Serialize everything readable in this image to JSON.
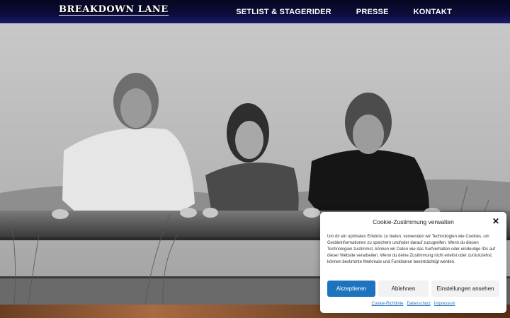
{
  "header": {
    "logo": "Breakdown Lane",
    "nav": [
      {
        "label": "SETLIST & STAGERIDER"
      },
      {
        "label": "PRESSE"
      },
      {
        "label": "KONTAKT"
      }
    ]
  },
  "cookie": {
    "title": "Cookie-Zustimmung verwalten",
    "close": "✕",
    "text": "Um dir ein optimales Erlebnis zu bieten, verwenden wir Technologien wie Cookies, um Geräteinformationen zu speichern und/oder darauf zuzugreifen. Wenn du diesen Technologien zustimmst, können wir Daten wie das Surfverhalten oder eindeutige IDs auf dieser Website verarbeiten. Wenn du deine Zustimmung nicht erteilst oder zurückziehst, können bestimmte Merkmale und Funktionen beeinträchtigt werden.",
    "buttons": {
      "accept": "Akzeptieren",
      "decline": "Ablehnen",
      "settings": "Einstellungen ansehen"
    },
    "links": [
      "Cookie-Richtlinie",
      "Datenschutz",
      "Impressum"
    ]
  },
  "colors": {
    "header": "#0c0c3c",
    "accent": "#1e73be"
  }
}
